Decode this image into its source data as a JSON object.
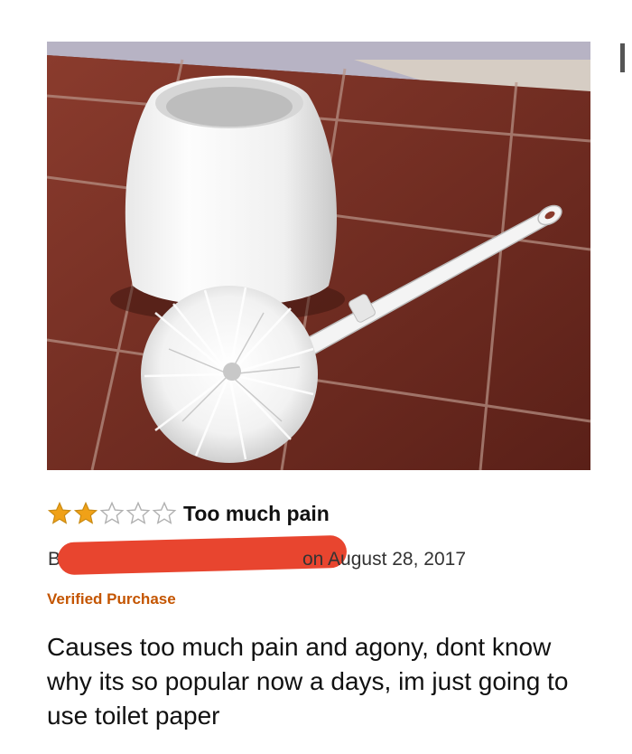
{
  "review": {
    "product_image": {
      "depicts": "toilet-brush-and-holder"
    },
    "rating": {
      "stars_filled": 2,
      "stars_total": 5,
      "filled_color": "#f0a117",
      "empty_color": "#c9c9c9"
    },
    "title": "Too much pain",
    "author_initial": "B",
    "author_redaction_color": "#e8452f",
    "date": "on August 28, 2017",
    "verified": "Verified Purchase",
    "verified_color": "#c45500",
    "body": "Causes too much pain and agony, dont know why its so popular now a days, im just going to use toilet paper"
  }
}
